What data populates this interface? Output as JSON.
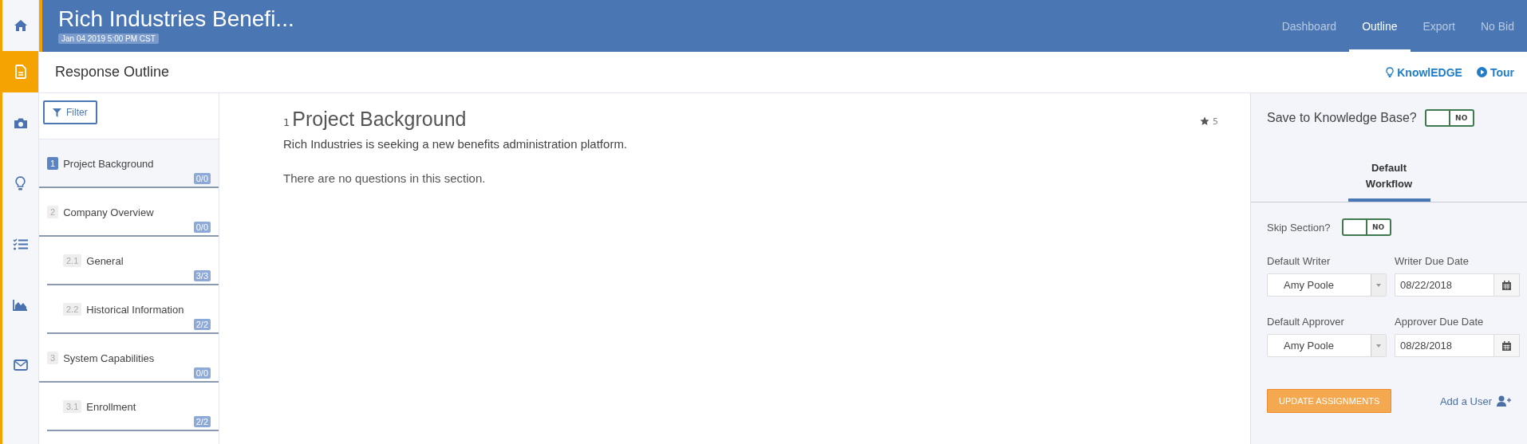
{
  "rail": [
    {
      "kind": "home",
      "selected": false
    },
    {
      "kind": "document",
      "selected": true
    },
    {
      "kind": "camera",
      "selected": false
    },
    {
      "kind": "bulb",
      "selected": false
    },
    {
      "kind": "checklist",
      "selected": false
    },
    {
      "kind": "chart",
      "selected": false
    },
    {
      "kind": "mail",
      "selected": false
    }
  ],
  "header": {
    "title": "Rich Industries Benefi...",
    "due": "Jan 04 2019 5:00 PM CST",
    "tabs": [
      {
        "label": "Dashboard",
        "selected": false
      },
      {
        "label": "Outline",
        "selected": true
      },
      {
        "label": "Export",
        "selected": false
      },
      {
        "label": "No Bid",
        "selected": false
      }
    ]
  },
  "subheader": {
    "title": "Response Outline",
    "links": [
      {
        "kind": "bulb",
        "label": "KnowlEDGE"
      },
      {
        "kind": "play",
        "label": "Tour"
      }
    ]
  },
  "outline": {
    "filter": "Filter",
    "items": [
      {
        "number": "1",
        "label": "Project Background",
        "count": "0/0",
        "selected": true
      },
      {
        "number": "2",
        "label": "Company Overview",
        "count": "0/0",
        "selected": false,
        "children": [
          {
            "number": "2.1",
            "label": "General",
            "count": "3/3",
            "selected": false
          },
          {
            "number": "2.2",
            "label": "Historical Information",
            "count": "2/2",
            "selected": false
          }
        ]
      },
      {
        "number": "3",
        "label": "System Capabilities",
        "count": "0/0",
        "selected": false,
        "children": [
          {
            "number": "3.1",
            "label": "Enrollment",
            "count": "2/2",
            "selected": false
          }
        ]
      }
    ]
  },
  "section": {
    "number": "1",
    "title": "Project Background",
    "stars": "5",
    "description": "Rich Industries is seeking a new benefits administration platform.",
    "empty_note": "There are no questions in this section."
  },
  "panel": {
    "save_label": "Save to Knowledge Base?",
    "save_toggle": {
      "on": false,
      "label": "NO"
    },
    "tab": {
      "label": "Default Workflow",
      "selected": true
    },
    "skip_label": "Skip Section?",
    "skip_toggle": {
      "on": false,
      "label": "NO"
    },
    "rows": [
      {
        "select_label": "Default Writer",
        "select_value": "Amy Poole",
        "date_label": "Writer Due Date",
        "date_value": "08/22/2018"
      },
      {
        "select_label": "Default Approver",
        "select_value": "Amy Poole",
        "date_label": "Approver Due Date",
        "date_value": "08/28/2018"
      }
    ],
    "button": "UPDATE ASSIGNMENTS",
    "add_user": "Add a User"
  }
}
